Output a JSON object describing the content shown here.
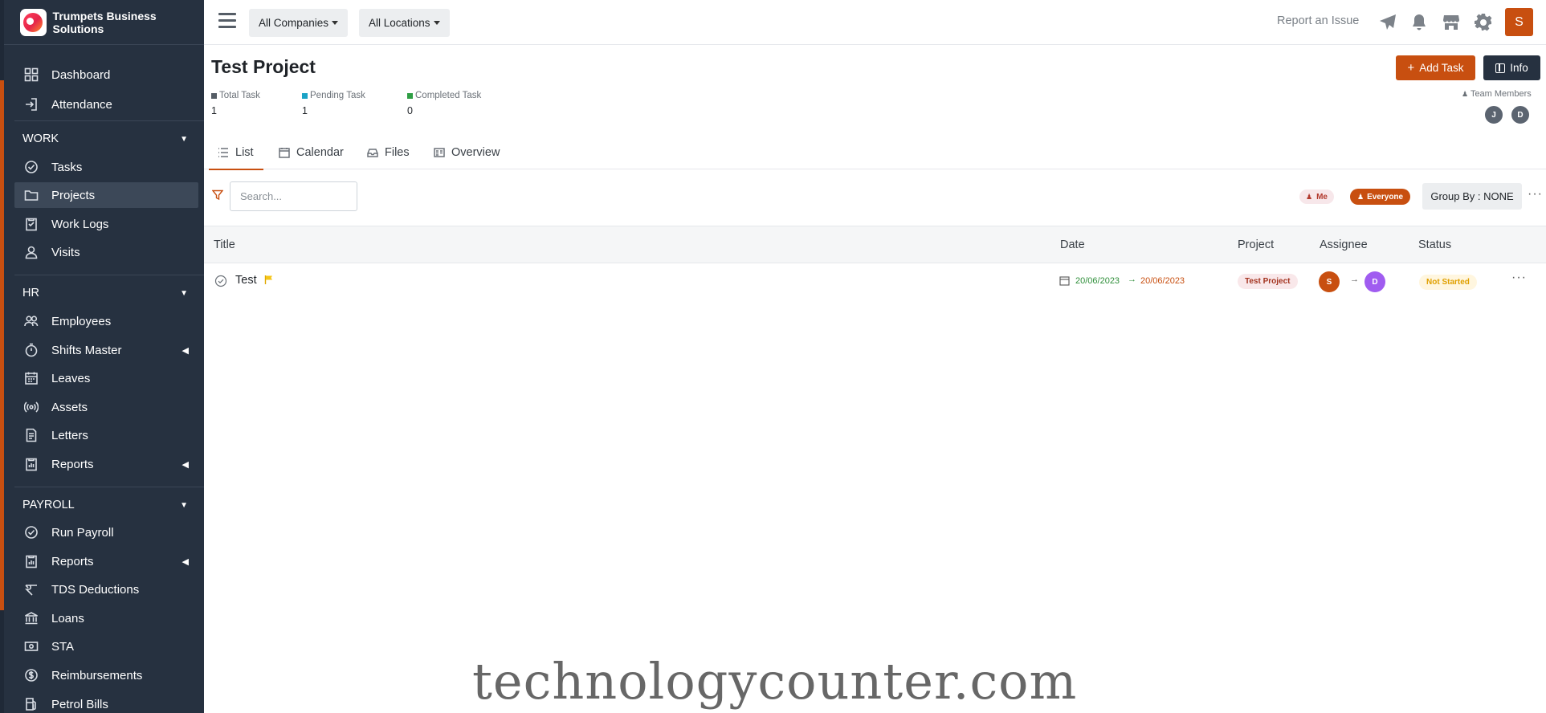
{
  "brand": {
    "name": "Trumpets Business Solutions"
  },
  "sidebar": {
    "top_items": [
      {
        "label": "Dashboard",
        "icon": "grid-icon"
      },
      {
        "label": "Attendance",
        "icon": "login-icon"
      }
    ],
    "sections": [
      {
        "label": "WORK",
        "items": [
          {
            "label": "Tasks",
            "icon": "check-circle-icon"
          },
          {
            "label": "Projects",
            "icon": "folder-icon",
            "active": true
          },
          {
            "label": "Work Logs",
            "icon": "clipboard-icon"
          },
          {
            "label": "Visits",
            "icon": "person-icon"
          }
        ]
      },
      {
        "label": "HR",
        "items": [
          {
            "label": "Employees",
            "icon": "people-icon"
          },
          {
            "label": "Shifts Master",
            "icon": "stopwatch-icon",
            "has_submenu": true
          },
          {
            "label": "Leaves",
            "icon": "calendar-icon"
          },
          {
            "label": "Assets",
            "icon": "broadcast-icon"
          },
          {
            "label": "Letters",
            "icon": "document-icon"
          },
          {
            "label": "Reports",
            "icon": "report-icon",
            "has_submenu": true
          }
        ]
      },
      {
        "label": "PAYROLL",
        "items": [
          {
            "label": "Run Payroll",
            "icon": "check-circle-icon"
          },
          {
            "label": "Reports",
            "icon": "report-icon",
            "has_submenu": true
          },
          {
            "label": "TDS Deductions",
            "icon": "percent-icon"
          },
          {
            "label": "Loans",
            "icon": "bank-icon"
          },
          {
            "label": "STA",
            "icon": "cash-icon"
          },
          {
            "label": "Reimbursements",
            "icon": "dollar-circle-icon"
          },
          {
            "label": "Petrol Bills",
            "icon": "fuel-icon"
          }
        ]
      }
    ]
  },
  "topbar": {
    "company_dropdown": "All Companies",
    "location_dropdown": "All Locations",
    "report_issue": "Report an Issue",
    "user_initial": "S"
  },
  "page": {
    "title": "Test Project",
    "add_task_label": "Add Task",
    "info_label": "Info",
    "stats": [
      {
        "label": "Total Task",
        "value": "1",
        "color": "#555d66"
      },
      {
        "label": "Pending Task",
        "value": "1",
        "color": "#1ba3c6"
      },
      {
        "label": "Completed Task",
        "value": "0",
        "color": "#2f9e44"
      }
    ],
    "team_label": "Team Members",
    "team_members": [
      "J",
      "D"
    ],
    "tabs": [
      {
        "label": "List",
        "icon": "list-icon",
        "active": true
      },
      {
        "label": "Calendar",
        "icon": "calendar-icon"
      },
      {
        "label": "Files",
        "icon": "inbox-icon"
      },
      {
        "label": "Overview",
        "icon": "overview-icon"
      }
    ],
    "search_placeholder": "Search...",
    "chip_me": "Me",
    "chip_everyone": "Everyone",
    "group_by": "Group By : NONE"
  },
  "table": {
    "columns": [
      "Title",
      "Date",
      "Project",
      "Assignee",
      "Status"
    ],
    "rows": [
      {
        "title": "Test",
        "start_date": "20/06/2023",
        "end_date": "20/06/2023",
        "project": "Test Project",
        "assigner": "S",
        "assignee": "D",
        "status": "Not Started"
      }
    ]
  },
  "watermark": "technologycounter.com",
  "colors": {
    "accent": "#c84f10",
    "sidebar_bg": "#263140",
    "assignee_d": "#a05cf0"
  }
}
